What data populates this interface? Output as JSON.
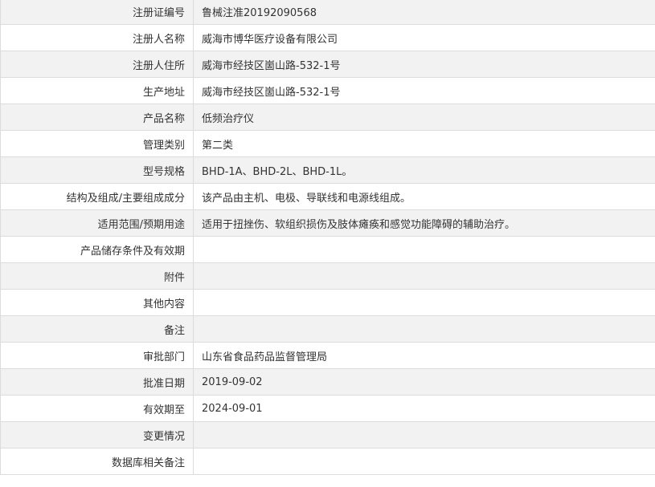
{
  "rows": [
    {
      "label": "注册证编号",
      "value": "鲁械注准20192090568"
    },
    {
      "label": "注册人名称",
      "value": "威海市博华医疗设备有限公司"
    },
    {
      "label": "注册人住所",
      "value": "威海市经技区崮山路-532-1号"
    },
    {
      "label": "生产地址",
      "value": "威海市经技区崮山路-532-1号"
    },
    {
      "label": "产品名称",
      "value": "低频治疗仪"
    },
    {
      "label": "管理类别",
      "value": "第二类"
    },
    {
      "label": "型号规格",
      "value": "BHD-1A、BHD-2L、BHD-1L。"
    },
    {
      "label": "结构及组成/主要组成成分",
      "value": "该产品由主机、电极、导联线和电源线组成。"
    },
    {
      "label": "适用范围/预期用途",
      "value": "适用于扭挫伤、软组织损伤及肢体瘫痪和感觉功能障碍的辅助治疗。"
    },
    {
      "label": "产品储存条件及有效期",
      "value": ""
    },
    {
      "label": "附件",
      "value": ""
    },
    {
      "label": "其他内容",
      "value": ""
    },
    {
      "label": "备注",
      "value": ""
    },
    {
      "label": "审批部门",
      "value": "山东省食品药品监督管理局"
    },
    {
      "label": "批准日期",
      "value": "2019-09-02"
    },
    {
      "label": "有效期至",
      "value": "2024-09-01"
    },
    {
      "label": "变更情况",
      "value": ""
    },
    {
      "label": "数据库相关备注",
      "value": ""
    }
  ],
  "colors": {
    "row_odd_bg": "#f2f2f2",
    "row_even_bg": "#ffffff",
    "border": "#dcdcdc",
    "text": "#333333"
  }
}
